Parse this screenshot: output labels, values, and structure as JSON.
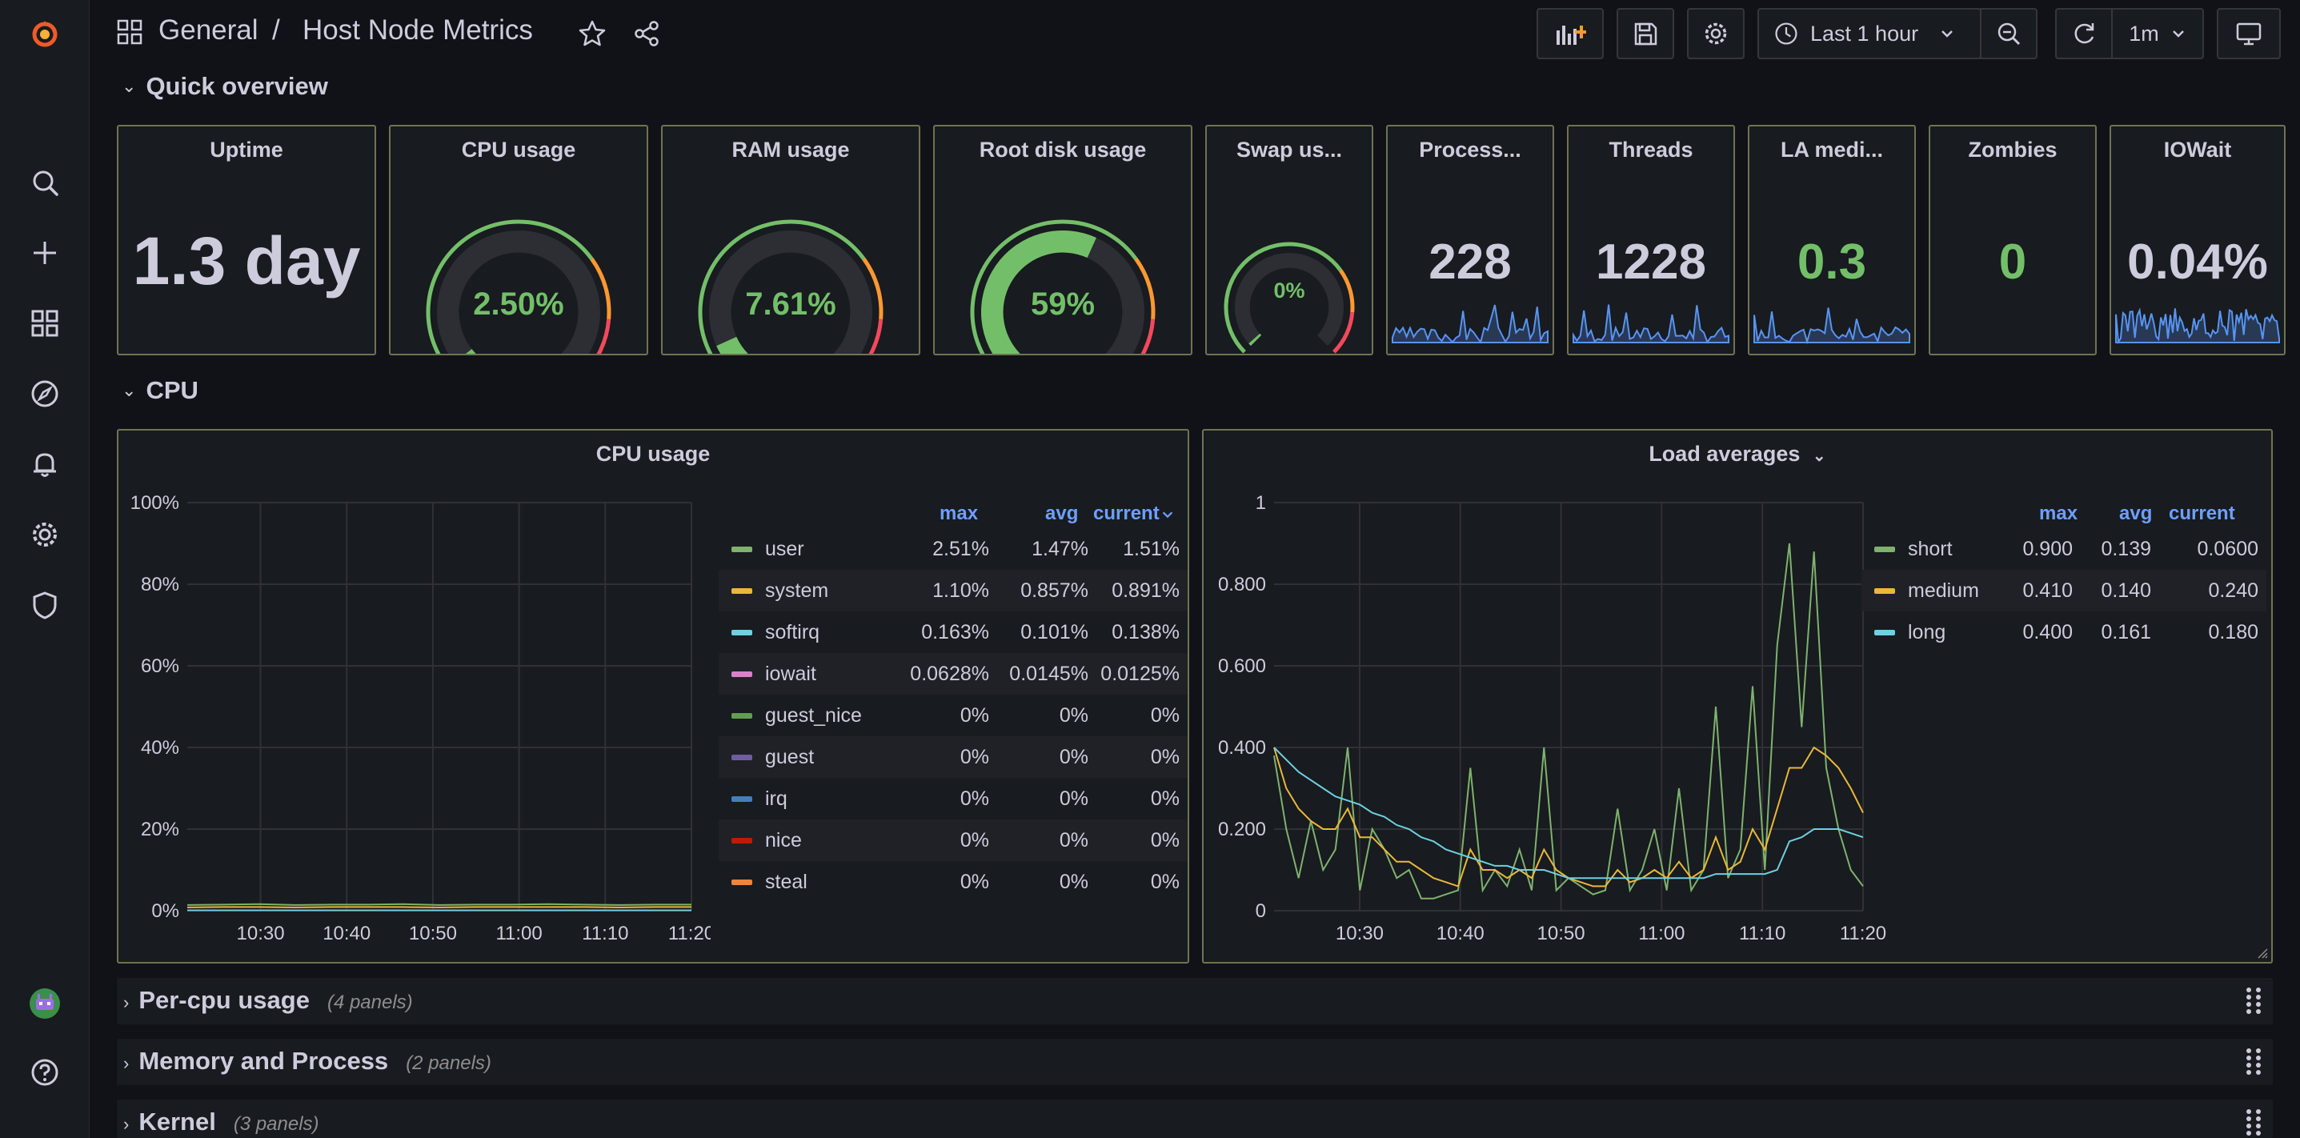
{
  "sidebar": {
    "items": [
      "logo-icon",
      "search-icon",
      "plus-icon",
      "dashboards-icon",
      "explore-icon",
      "alerting-icon",
      "gear-icon",
      "shield-icon",
      "avatar",
      "help-icon"
    ]
  },
  "header": {
    "folder": "General",
    "separator": "/",
    "title": "Host Node Metrics",
    "time_range": "Last 1 hour",
    "refresh_interval": "1m"
  },
  "rows": {
    "quick_overview": "Quick overview",
    "cpu": "CPU",
    "per_cpu": {
      "title": "Per-cpu usage",
      "count": "(4 panels)"
    },
    "memory": {
      "title": "Memory and Process",
      "count": "(2 panels)"
    },
    "kernel": {
      "title": "Kernel",
      "count": "(3 panels)"
    }
  },
  "stats": {
    "uptime": {
      "title": "Uptime",
      "value": "1.3 day"
    },
    "cpu_usage": {
      "title": "CPU usage",
      "value": "2.50%",
      "fraction": 0.025
    },
    "ram_usage": {
      "title": "RAM usage",
      "value": "7.61%",
      "fraction": 0.0761
    },
    "disk_usage": {
      "title": "Root disk usage",
      "value": "59%",
      "fraction": 0.59
    },
    "swap_usage": {
      "title": "Swap us...",
      "value": "0%",
      "fraction": 0.0
    },
    "processes": {
      "title": "Process...",
      "value": "228"
    },
    "threads": {
      "title": "Threads",
      "value": "1228"
    },
    "la_medium": {
      "title": "LA medi...",
      "value": "0.3"
    },
    "zombies": {
      "title": "Zombies",
      "value": "0"
    },
    "iowait": {
      "title": "IOWait",
      "value": "0.04%"
    }
  },
  "colors": {
    "green": "#73bf69",
    "yellow": "#e0b400",
    "orange": "#ff9830",
    "red": "#f2495c",
    "blue": "#5794f2",
    "link_blue": "#6e9fff",
    "text": "#ccccdc"
  },
  "cpu_panel": {
    "title": "CPU usage",
    "legend_headers": {
      "max": "max",
      "avg": "avg",
      "current": "current"
    },
    "legend": [
      {
        "name": "user",
        "max": "2.51%",
        "avg": "1.47%",
        "current": "1.51%",
        "color": "#7eb26d"
      },
      {
        "name": "system",
        "max": "1.10%",
        "avg": "0.857%",
        "current": "0.891%",
        "color": "#eab839"
      },
      {
        "name": "softirq",
        "max": "0.163%",
        "avg": "0.101%",
        "current": "0.138%",
        "color": "#6ed0e0"
      },
      {
        "name": "iowait",
        "max": "0.0628%",
        "avg": "0.0145%",
        "current": "0.0125%",
        "color": "#d683ce"
      },
      {
        "name": "guest_nice",
        "max": "0%",
        "avg": "0%",
        "current": "0%",
        "color": "#629e51"
      },
      {
        "name": "guest",
        "max": "0%",
        "avg": "0%",
        "current": "0%",
        "color": "#705da0"
      },
      {
        "name": "irq",
        "max": "0%",
        "avg": "0%",
        "current": "0%",
        "color": "#447ebc"
      },
      {
        "name": "nice",
        "max": "0%",
        "avg": "0%",
        "current": "0%",
        "color": "#bf1b00"
      },
      {
        "name": "steal",
        "max": "0%",
        "avg": "0%",
        "current": "0%",
        "color": "#ef843c"
      }
    ]
  },
  "load_panel": {
    "title": "Load averages",
    "legend_headers": {
      "max": "max",
      "avg": "avg",
      "current": "current"
    },
    "legend": [
      {
        "name": "short",
        "max": "0.900",
        "avg": "0.139",
        "current": "0.0600",
        "color": "#7eb26d"
      },
      {
        "name": "medium",
        "max": "0.410",
        "avg": "0.140",
        "current": "0.240",
        "color": "#eab839"
      },
      {
        "name": "long",
        "max": "0.400",
        "avg": "0.161",
        "current": "0.180",
        "color": "#6ed0e0"
      }
    ]
  },
  "chart_data": [
    {
      "type": "line",
      "title": "CPU usage",
      "x_ticks": [
        "10:30",
        "10:40",
        "10:50",
        "11:00",
        "11:10",
        "11:20"
      ],
      "y_ticks": [
        "0%",
        "20%",
        "40%",
        "60%",
        "80%",
        "100%"
      ],
      "ylim": [
        0,
        100
      ],
      "series": [
        {
          "name": "user",
          "values": [
            1.4,
            1.5,
            1.6,
            1.4,
            1.5,
            1.5,
            1.6,
            1.4,
            1.5,
            1.5,
            1.6,
            1.5,
            1.4,
            1.5,
            1.5
          ]
        },
        {
          "name": "system",
          "values": [
            0.8,
            0.9,
            0.9,
            0.8,
            0.9,
            0.9,
            0.9,
            0.8,
            0.9,
            0.9,
            0.9,
            0.9,
            0.8,
            0.9,
            0.9
          ]
        },
        {
          "name": "softirq",
          "values": [
            0.1,
            0.1,
            0.1,
            0.1,
            0.1,
            0.1,
            0.1,
            0.1,
            0.1,
            0.1,
            0.1,
            0.1,
            0.1,
            0.1,
            0.1
          ]
        }
      ]
    },
    {
      "type": "line",
      "title": "Load averages",
      "x_ticks": [
        "10:30",
        "10:40",
        "10:50",
        "11:00",
        "11:10",
        "11:20"
      ],
      "y_ticks": [
        "0",
        "0.200",
        "0.400",
        "0.600",
        "0.800",
        "1"
      ],
      "ylim": [
        0,
        1
      ],
      "series": [
        {
          "name": "short",
          "values": [
            0.38,
            0.2,
            0.08,
            0.22,
            0.1,
            0.15,
            0.4,
            0.05,
            0.2,
            0.15,
            0.08,
            0.1,
            0.03,
            0.03,
            0.04,
            0.05,
            0.35,
            0.05,
            0.1,
            0.06,
            0.15,
            0.05,
            0.4,
            0.05,
            0.08,
            0.06,
            0.04,
            0.05,
            0.25,
            0.05,
            0.1,
            0.2,
            0.05,
            0.3,
            0.05,
            0.1,
            0.5,
            0.08,
            0.15,
            0.55,
            0.1,
            0.65,
            0.9,
            0.45,
            0.88,
            0.35,
            0.2,
            0.1,
            0.06
          ]
        },
        {
          "name": "medium",
          "values": [
            0.4,
            0.3,
            0.25,
            0.22,
            0.2,
            0.2,
            0.25,
            0.18,
            0.18,
            0.15,
            0.12,
            0.12,
            0.1,
            0.08,
            0.07,
            0.06,
            0.15,
            0.1,
            0.1,
            0.08,
            0.1,
            0.08,
            0.15,
            0.1,
            0.08,
            0.07,
            0.06,
            0.06,
            0.1,
            0.07,
            0.08,
            0.1,
            0.08,
            0.12,
            0.08,
            0.1,
            0.18,
            0.1,
            0.12,
            0.2,
            0.15,
            0.25,
            0.35,
            0.35,
            0.4,
            0.38,
            0.35,
            0.3,
            0.24
          ]
        },
        {
          "name": "long",
          "values": [
            0.4,
            0.37,
            0.34,
            0.32,
            0.3,
            0.28,
            0.27,
            0.26,
            0.24,
            0.23,
            0.21,
            0.2,
            0.18,
            0.17,
            0.15,
            0.14,
            0.13,
            0.12,
            0.11,
            0.11,
            0.1,
            0.1,
            0.1,
            0.09,
            0.08,
            0.08,
            0.08,
            0.08,
            0.08,
            0.08,
            0.08,
            0.08,
            0.08,
            0.08,
            0.08,
            0.08,
            0.09,
            0.09,
            0.09,
            0.09,
            0.09,
            0.1,
            0.17,
            0.18,
            0.2,
            0.2,
            0.2,
            0.19,
            0.18
          ]
        }
      ]
    }
  ]
}
